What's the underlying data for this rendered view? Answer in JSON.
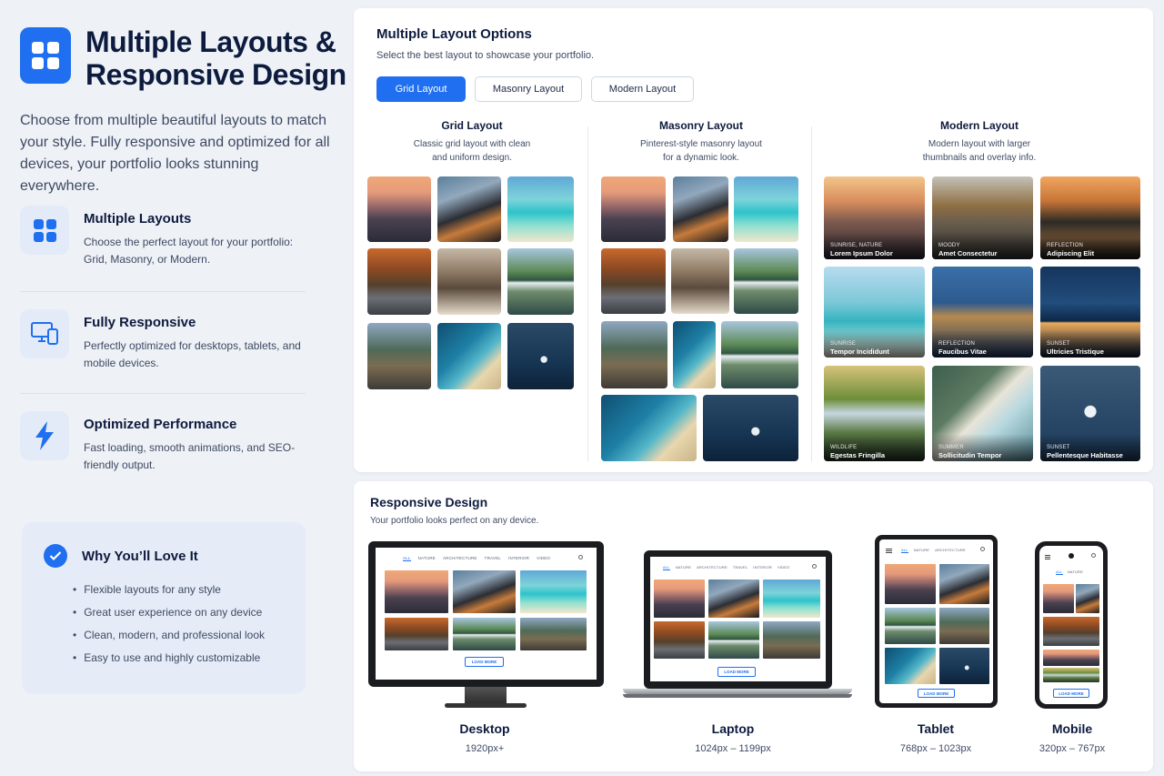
{
  "hero": {
    "title": "Multiple Layouts & Responsive Design",
    "intro": "Choose from multiple beautiful layouts to match your style. Fully responsive and optimized for all devices, your portfolio looks stunning everywhere."
  },
  "features": [
    {
      "title": "Multiple Layouts",
      "desc": "Choose the perfect layout for your portfolio: Grid, Masonry, or Modern.",
      "icon": "grid-icon"
    },
    {
      "title": "Fully Responsive",
      "desc": "Perfectly optimized for desktops, tablets, and mobile devices.",
      "icon": "devices-icon"
    },
    {
      "title": "Optimized Performance",
      "desc": "Fast loading, smooth animations, and SEO-friendly output.",
      "icon": "lightning-icon"
    }
  ],
  "why": {
    "title": "Why You’ll Love It",
    "items": [
      "Flexible layouts for any style",
      "Great user experience on any device",
      "Clean, modern, and professional look",
      "Easy to use and highly customizable"
    ]
  },
  "layouts": {
    "title": "Multiple Layout Options",
    "subtitle": "Select the best layout to showcase your portfolio.",
    "tabs": [
      {
        "label": "Grid Layout",
        "active": true
      },
      {
        "label": "Masonry Layout",
        "active": false
      },
      {
        "label": "Modern Layout",
        "active": false
      }
    ],
    "columns": [
      {
        "title": "Grid Layout",
        "desc": "Classic grid layout with clean and uniform design."
      },
      {
        "title": "Masonry Layout",
        "desc": "Pinterest-style masonry layout for a dynamic look."
      },
      {
        "title": "Modern Layout",
        "desc": "Modern layout with larger thumbnails and overlay info."
      }
    ],
    "modern_items": [
      {
        "tag": "SUNRISE, NATURE",
        "name": "Lorem Ipsum Dolor"
      },
      {
        "tag": "MOODY",
        "name": "Amet Consectetur"
      },
      {
        "tag": "REFLECTION",
        "name": "Adipiscing Elit"
      },
      {
        "tag": "SUNRISE",
        "name": "Tempor Incididunt"
      },
      {
        "tag": "REFLECTION",
        "name": "Faucibus Vitae"
      },
      {
        "tag": "SUNSET",
        "name": "Ultricies Tristique"
      },
      {
        "tag": "WILDLIFE",
        "name": "Egestas Fringilla"
      },
      {
        "tag": "SUMMER",
        "name": "Sollicitudin Tempor"
      },
      {
        "tag": "SUNSET",
        "name": "Pellentesque Habitasse"
      }
    ]
  },
  "responsive": {
    "title": "Responsive Design",
    "subtitle": "Your portfolio looks perfect on any device.",
    "nav": {
      "all": "ALL",
      "nature": "NATURE",
      "architecture": "ARCHITECTURE",
      "travel": "TRAVEL",
      "interior": "INTERIOR",
      "video": "VIDEO"
    },
    "load_more": "LOAD MORE",
    "devices": [
      {
        "name": "Desktop",
        "range": "1920px+"
      },
      {
        "name": "Laptop",
        "range": "1024px – 1199px"
      },
      {
        "name": "Tablet",
        "range": "768px – 1023px"
      },
      {
        "name": "Mobile",
        "range": "320px – 767px"
      }
    ]
  },
  "colors": {
    "accent": "#1f6ff0",
    "text": "#0d1b3e",
    "background": "#eef1f6"
  }
}
